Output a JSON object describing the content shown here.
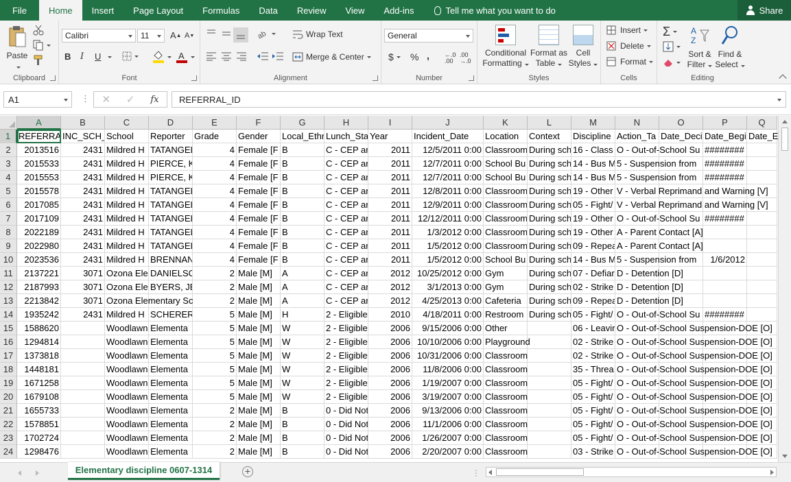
{
  "ribbon_tabs": [
    "File",
    "Home",
    "Insert",
    "Page Layout",
    "Formulas",
    "Data",
    "Review",
    "View",
    "Add-ins"
  ],
  "active_tab": "Home",
  "tell_me": "Tell me what you want to do",
  "share_label": "Share",
  "clipboard": {
    "paste": "Paste",
    "label": "Clipboard"
  },
  "font": {
    "name": "Calibri",
    "size": "11",
    "bold": "B",
    "italic": "I",
    "underline": "U",
    "label": "Font"
  },
  "alignment": {
    "wrap_text": "Wrap Text",
    "merge_center": "Merge & Center",
    "label": "Alignment"
  },
  "number": {
    "format": "General",
    "currency": "$",
    "percent": "%",
    "comma": ",",
    "label": "Number"
  },
  "styles": {
    "conditional_1": "Conditional",
    "conditional_2": "Formatting",
    "format_as_1": "Format as",
    "format_as_2": "Table",
    "cell_styles_1": "Cell",
    "cell_styles_2": "Styles",
    "label": "Styles"
  },
  "cells": {
    "insert": "Insert",
    "delete": "Delete",
    "format": "Format",
    "label": "Cells"
  },
  "editing": {
    "sort_1": "Sort &",
    "sort_2": "Filter",
    "find_1": "Find &",
    "find_2": "Select",
    "label": "Editing"
  },
  "formula_bar": {
    "name_box": "A1",
    "content": "REFERRAL_ID",
    "fx": "fx"
  },
  "columns": [
    "A",
    "B",
    "C",
    "D",
    "E",
    "F",
    "G",
    "H",
    "I",
    "J",
    "K",
    "L",
    "M",
    "N",
    "O",
    "P",
    "Q"
  ],
  "rows": [
    [
      "REFERRAL",
      "INC_SCH_",
      "School",
      "Reporter",
      "Grade",
      "Gender",
      "Local_Ethr",
      "Lunch_Sta",
      "Year",
      "Incident_Date",
      "Location",
      "Context",
      "Discipline",
      "Action_Ta",
      "Date_Deci",
      "Date_Begi",
      "Date_E"
    ],
    [
      "2013516",
      "2431",
      "Mildred H",
      "TATANGEL",
      "4",
      "Female [F",
      "B",
      "C - CEP an",
      "2011",
      "12/5/2011 0:00",
      "Classroom",
      "During sch",
      "16 - Class ,",
      "O - Out-of-School Su",
      "",
      "########",
      ""
    ],
    [
      "2015533",
      "2431",
      "Mildred H",
      "PIERCE, KA",
      "4",
      "Female [F",
      "B",
      "C - CEP an",
      "2011",
      "12/7/2011 0:00",
      "School Bu",
      "During sch",
      "14 - Bus M",
      "5 - Suspension from",
      "",
      "########",
      ""
    ],
    [
      "2015553",
      "2431",
      "Mildred H",
      "PIERCE, KA",
      "4",
      "Female [F",
      "B",
      "C - CEP an",
      "2011",
      "12/7/2011 0:00",
      "School Bu",
      "During sch",
      "14 - Bus M",
      "5 - Suspension from",
      "",
      "########",
      ""
    ],
    [
      "2015578",
      "2431",
      "Mildred H",
      "TATANGEL",
      "4",
      "Female [F",
      "B",
      "C - CEP an",
      "2011",
      "12/8/2011 0:00",
      "Classroom",
      "During sch",
      "19 - Other",
      "V - Verbal Reprimand and Warning [V]",
      "",
      "",
      ""
    ],
    [
      "2017085",
      "2431",
      "Mildred H",
      "TATANGEL",
      "4",
      "Female [F",
      "B",
      "C - CEP an",
      "2011",
      "12/9/2011 0:00",
      "Classroom",
      "During sch",
      "05 - Fight/",
      "V - Verbal Reprimand and Warning [V]",
      "",
      "",
      ""
    ],
    [
      "2017109",
      "2431",
      "Mildred H",
      "TATANGEL",
      "4",
      "Female [F",
      "B",
      "C - CEP an",
      "2011",
      "12/12/2011 0:00",
      "Classroom",
      "During sch",
      "19 - Other",
      "O - Out-of-School Su",
      "",
      "########",
      ""
    ],
    [
      "2022189",
      "2431",
      "Mildred H",
      "TATANGEL",
      "4",
      "Female [F",
      "B",
      "C - CEP an",
      "2011",
      "1/3/2012 0:00",
      "Classroom",
      "During sch",
      "19 - Other",
      "A - Parent Contact [A]",
      "",
      "",
      ""
    ],
    [
      "2022980",
      "2431",
      "Mildred H",
      "TATANGEL",
      "4",
      "Female [F",
      "B",
      "C - CEP an",
      "2011",
      "1/5/2012 0:00",
      "Classroom",
      "During sch",
      "09 - Repea",
      "A - Parent Contact [A]",
      "",
      "",
      ""
    ],
    [
      "2023536",
      "2431",
      "Mildred H",
      "BRENNAN",
      "4",
      "Female [F",
      "B",
      "C - CEP an",
      "2011",
      "1/5/2012 0:00",
      "School Bu",
      "During sch",
      "14 - Bus M",
      "5 - Suspension from",
      "",
      "1/6/2012",
      ""
    ],
    [
      "2137221",
      "3071",
      "Ozona Ele",
      "DANIELSO",
      "2",
      "Male [M]",
      "A",
      "C - CEP an",
      "2012",
      "10/25/2012 0:00",
      "Gym",
      "During sch",
      "07 - Defiar",
      "D - Detention [D]",
      "",
      "",
      ""
    ],
    [
      "2187993",
      "3071",
      "Ozona Ele",
      "BYERS, JEN",
      "2",
      "Male [M]",
      "A",
      "C - CEP an",
      "2012",
      "3/1/2013 0:00",
      "Gym",
      "During sch",
      "02 - Strike",
      "D - Detention [D]",
      "",
      "",
      ""
    ],
    [
      "2213842",
      "3071",
      "Ozona Elementary Sc",
      "",
      "2",
      "Male [M]",
      "A",
      "C - CEP an",
      "2012",
      "4/25/2013 0:00",
      "Cafeteria",
      "During sch",
      "09 - Repea",
      "D - Detention [D]",
      "",
      "",
      ""
    ],
    [
      "1935242",
      "2431",
      "Mildred H",
      "SCHERER,",
      "5",
      "Male [M]",
      "H",
      "2 - Eligible",
      "2010",
      "4/18/2011 0:00",
      "Restroom",
      "During sch",
      "05 - Fight/",
      "O - Out-of-School Su",
      "",
      "########",
      ""
    ],
    [
      "1588620",
      "",
      "Woodlawn Elementa",
      "",
      "5",
      "Male [M]",
      "W",
      "2 - Eligible",
      "2006",
      "9/15/2006 0:00",
      "Other",
      "",
      "06 - Leavir",
      "O - Out-of-School Suspension-DOE [O]",
      "",
      "",
      ""
    ],
    [
      "1294814",
      "",
      "Woodlawn Elementa",
      "",
      "5",
      "Male [M]",
      "W",
      "2 - Eligible",
      "2006",
      "10/10/2006 0:00",
      "Playground",
      "",
      "02 - Strike",
      "O - Out-of-School Suspension-DOE [O]",
      "",
      "",
      ""
    ],
    [
      "1373818",
      "",
      "Woodlawn Elementa",
      "",
      "5",
      "Male [M]",
      "W",
      "2 - Eligible",
      "2006",
      "10/31/2006 0:00",
      "Classroom",
      "",
      "02 - Strike",
      "O - Out-of-School Suspension-DOE [O]",
      "",
      "",
      ""
    ],
    [
      "1448181",
      "",
      "Woodlawn Elementa",
      "",
      "5",
      "Male [M]",
      "W",
      "2 - Eligible",
      "2006",
      "11/8/2006 0:00",
      "Classroom",
      "",
      "35 - Threa",
      "O - Out-of-School Suspension-DOE [O]",
      "",
      "",
      ""
    ],
    [
      "1671258",
      "",
      "Woodlawn Elementa",
      "",
      "5",
      "Male [M]",
      "W",
      "2 - Eligible",
      "2006",
      "1/19/2007 0:00",
      "Classroom",
      "",
      "05 - Fight/",
      "O - Out-of-School Suspension-DOE [O]",
      "",
      "",
      ""
    ],
    [
      "1679108",
      "",
      "Woodlawn Elementa",
      "",
      "5",
      "Male [M]",
      "W",
      "2 - Eligible",
      "2006",
      "3/19/2007 0:00",
      "Classroom",
      "",
      "05 - Fight/",
      "O - Out-of-School Suspension-DOE [O]",
      "",
      "",
      ""
    ],
    [
      "1655733",
      "",
      "Woodlawn Elementa",
      "",
      "2",
      "Male [M]",
      "B",
      "0 - Did Not",
      "2006",
      "9/13/2006 0:00",
      "Classroom",
      "",
      "05 - Fight/",
      "O - Out-of-School Suspension-DOE [O]",
      "",
      "",
      ""
    ],
    [
      "1578851",
      "",
      "Woodlawn Elementa",
      "",
      "2",
      "Male [M]",
      "B",
      "0 - Did Not",
      "2006",
      "11/1/2006 0:00",
      "Classroom",
      "",
      "05 - Fight/",
      "O - Out-of-School Suspension-DOE [O]",
      "",
      "",
      ""
    ],
    [
      "1702724",
      "",
      "Woodlawn Elementa",
      "",
      "2",
      "Male [M]",
      "B",
      "0 - Did Not",
      "2006",
      "1/26/2007 0:00",
      "Classroom",
      "",
      "05 - Fight/",
      "O - Out-of-School Suspension-DOE [O]",
      "",
      "",
      ""
    ],
    [
      "1298476",
      "",
      "Woodlawn Elementa",
      "",
      "2",
      "Male [M]",
      "B",
      "0 - Did Not",
      "2006",
      "2/20/2007 0:00",
      "Classroom",
      "",
      "03 - Strike",
      "O - Out-of-School Suspension-DOE [O]",
      "",
      "",
      ""
    ]
  ],
  "sheet_tab": "Elementary discipline 0607-1314"
}
